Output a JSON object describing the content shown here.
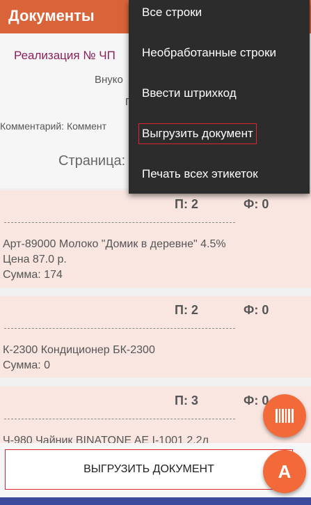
{
  "appbar": {
    "title": "Документы"
  },
  "document": {
    "title": "Реализация № ЧП",
    "line1": "Внуко",
    "line2": "П",
    "comment": "Комментарий: Коммент",
    "page": "Страница:"
  },
  "menu": {
    "items": [
      {
        "label": "Все строки"
      },
      {
        "label": "Необработанные строки"
      },
      {
        "label": "Ввести штрихкод"
      },
      {
        "label": "Выгрузить документ"
      },
      {
        "label": "Печать всех этикеток"
      }
    ]
  },
  "rows": [
    {
      "p": "П: 2",
      "f": "Ф: 0",
      "name": "Арт-89000 Молоко \"Домик в деревне\" 4.5%",
      "price": "Цена 87.0 р.",
      "sum": "Сумма: 174"
    },
    {
      "p": "П: 2",
      "f": "Ф: 0",
      "name": "К-2300 Кондиционер БК-2300",
      "sum": "Сумма: 0"
    },
    {
      "p": "П: 3",
      "f": "Ф: 0",
      "name": "Ч-980 Чайник BINATONE AE I-1001 2.2л"
    }
  ],
  "fab": {
    "a_label": "A",
    "barcode_icon": "barcode-icon"
  },
  "bottom": {
    "button_label": "ВЫГРУЗИТЬ ДОКУМЕНТ"
  },
  "colors": {
    "appbar": "#d9643a",
    "accent": "#f26a3a",
    "menu_bg": "#2c2c2c",
    "card_bg": "#f9e6e1",
    "highlight": "#e0232f",
    "navbar": "#3b4a9c"
  }
}
